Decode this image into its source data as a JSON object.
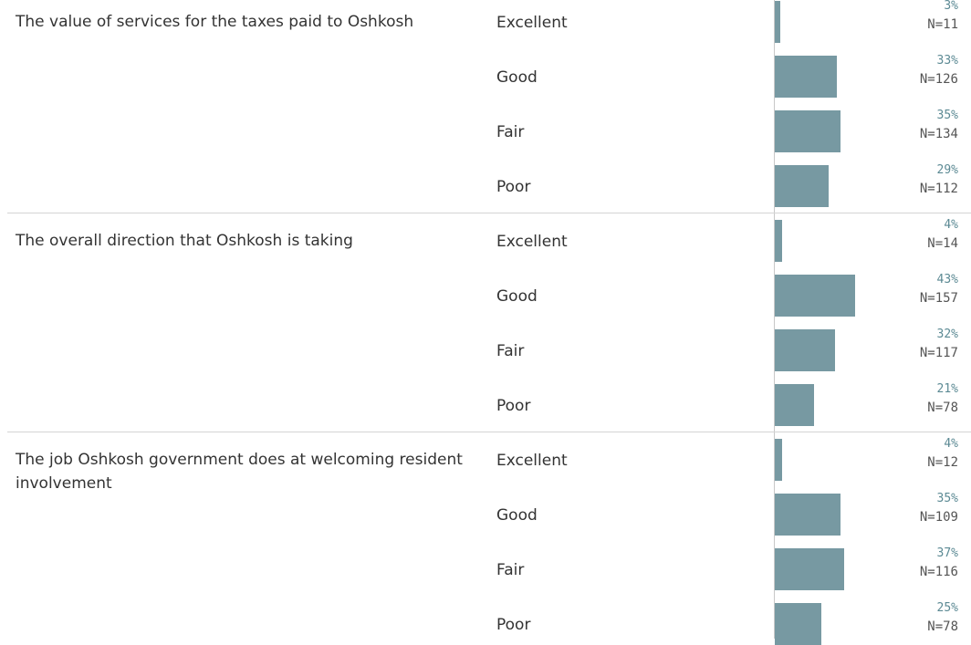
{
  "chart_data": {
    "type": "bar",
    "orientation": "horizontal",
    "bar_color": "#7799a2",
    "groups": [
      {
        "question": "The value of services for the taxes paid to Oshkosh",
        "rows": [
          {
            "rating": "Excellent",
            "pct": 3,
            "pct_label": "3%",
            "n_label": "N=11"
          },
          {
            "rating": "Good",
            "pct": 33,
            "pct_label": "33%",
            "n_label": "N=126"
          },
          {
            "rating": "Fair",
            "pct": 35,
            "pct_label": "35%",
            "n_label": "N=134"
          },
          {
            "rating": "Poor",
            "pct": 29,
            "pct_label": "29%",
            "n_label": "N=112"
          }
        ]
      },
      {
        "question": "The overall direction that Oshkosh is taking",
        "rows": [
          {
            "rating": "Excellent",
            "pct": 4,
            "pct_label": "4%",
            "n_label": "N=14"
          },
          {
            "rating": "Good",
            "pct": 43,
            "pct_label": "43%",
            "n_label": "N=157"
          },
          {
            "rating": "Fair",
            "pct": 32,
            "pct_label": "32%",
            "n_label": "N=117"
          },
          {
            "rating": "Poor",
            "pct": 21,
            "pct_label": "21%",
            "n_label": "N=78"
          }
        ]
      },
      {
        "question": "The job Oshkosh government does at welcoming resident involvement",
        "rows": [
          {
            "rating": "Excellent",
            "pct": 4,
            "pct_label": "4%",
            "n_label": "N=12"
          },
          {
            "rating": "Good",
            "pct": 35,
            "pct_label": "35%",
            "n_label": "N=109"
          },
          {
            "rating": "Fair",
            "pct": 37,
            "pct_label": "37%",
            "n_label": "N=116"
          },
          {
            "rating": "Poor",
            "pct": 25,
            "pct_label": "25%",
            "n_label": "N=78"
          }
        ]
      }
    ]
  }
}
